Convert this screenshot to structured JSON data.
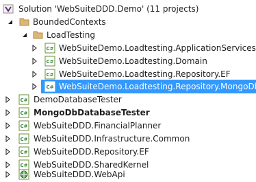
{
  "solution": {
    "label": "Solution 'WebSuiteDDD.Demo' (11 projects)",
    "icon": "solution-icon"
  },
  "folders": [
    {
      "label": "BoundedContexts",
      "icon": "folder-open-icon"
    },
    {
      "label": "LoadTesting",
      "icon": "folder-open-icon"
    }
  ],
  "loadtesting_projects": [
    {
      "label": "WebSuiteDemo.Loadtesting.ApplicationServices",
      "icon": "csharp-project-icon"
    },
    {
      "label": "WebSuiteDemo.Loadtesting.Domain",
      "icon": "csharp-project-icon"
    },
    {
      "label": "WebSuiteDemo.Loadtesting.Repository.EF",
      "icon": "csharp-project-icon"
    },
    {
      "label": "WebSuiteDemo.Loadtesting.Repository.MongoDb",
      "icon": "csharp-project-icon"
    }
  ],
  "root_projects": [
    {
      "label": "DemoDatabaseTester",
      "icon": "csharp-project-icon"
    },
    {
      "label": "MongoDbDatabaseTester",
      "icon": "csharp-project-icon"
    },
    {
      "label": "WebSuiteDDD.FinancialPlanner",
      "icon": "csharp-project-icon"
    },
    {
      "label": "WebSuiteDDD.Infrastructure.Common",
      "icon": "csharp-project-icon"
    },
    {
      "label": "WebSuiteDDD.Repository.EF",
      "icon": "csharp-project-icon"
    },
    {
      "label": "WebSuiteDDD.SharedKernel",
      "icon": "csharp-project-icon"
    },
    {
      "label": "WebSuiteDDD.WebApi",
      "icon": "web-project-icon"
    }
  ],
  "selected": "WebSuiteDemo.Loadtesting.Repository.MongoDb",
  "colors": {
    "selection": "#3399ff",
    "folder": "#dcb67a",
    "csharp": "#6a8e3a"
  }
}
